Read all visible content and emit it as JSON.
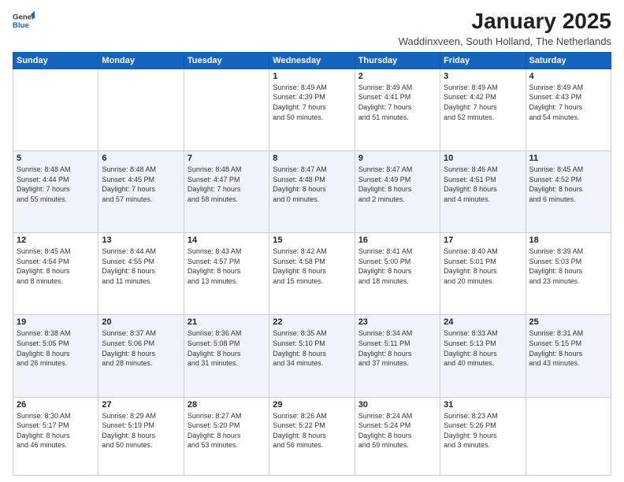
{
  "logo": {
    "general": "General",
    "blue": "Blue"
  },
  "title": "January 2025",
  "subtitle": "Waddinxveen, South Holland, The Netherlands",
  "headers": [
    "Sunday",
    "Monday",
    "Tuesday",
    "Wednesday",
    "Thursday",
    "Friday",
    "Saturday"
  ],
  "weeks": [
    [
      {
        "day": "",
        "info": ""
      },
      {
        "day": "",
        "info": ""
      },
      {
        "day": "",
        "info": ""
      },
      {
        "day": "1",
        "info": "Sunrise: 8:49 AM\nSunset: 4:39 PM\nDaylight: 7 hours\nand 50 minutes."
      },
      {
        "day": "2",
        "info": "Sunrise: 8:49 AM\nSunset: 4:41 PM\nDaylight: 7 hours\nand 51 minutes."
      },
      {
        "day": "3",
        "info": "Sunrise: 8:49 AM\nSunset: 4:42 PM\nDaylight: 7 hours\nand 52 minutes."
      },
      {
        "day": "4",
        "info": "Sunrise: 8:49 AM\nSunset: 4:43 PM\nDaylight: 7 hours\nand 54 minutes."
      }
    ],
    [
      {
        "day": "5",
        "info": "Sunrise: 8:48 AM\nSunset: 4:44 PM\nDaylight: 7 hours\nand 55 minutes."
      },
      {
        "day": "6",
        "info": "Sunrise: 8:48 AM\nSunset: 4:45 PM\nDaylight: 7 hours\nand 57 minutes."
      },
      {
        "day": "7",
        "info": "Sunrise: 8:48 AM\nSunset: 4:47 PM\nDaylight: 7 hours\nand 58 minutes."
      },
      {
        "day": "8",
        "info": "Sunrise: 8:47 AM\nSunset: 4:48 PM\nDaylight: 8 hours\nand 0 minutes."
      },
      {
        "day": "9",
        "info": "Sunrise: 8:47 AM\nSunset: 4:49 PM\nDaylight: 8 hours\nand 2 minutes."
      },
      {
        "day": "10",
        "info": "Sunrise: 8:46 AM\nSunset: 4:51 PM\nDaylight: 8 hours\nand 4 minutes."
      },
      {
        "day": "11",
        "info": "Sunrise: 8:45 AM\nSunset: 4:52 PM\nDaylight: 8 hours\nand 6 minutes."
      }
    ],
    [
      {
        "day": "12",
        "info": "Sunrise: 8:45 AM\nSunset: 4:54 PM\nDaylight: 8 hours\nand 8 minutes."
      },
      {
        "day": "13",
        "info": "Sunrise: 8:44 AM\nSunset: 4:55 PM\nDaylight: 8 hours\nand 11 minutes."
      },
      {
        "day": "14",
        "info": "Sunrise: 8:43 AM\nSunset: 4:57 PM\nDaylight: 8 hours\nand 13 minutes."
      },
      {
        "day": "15",
        "info": "Sunrise: 8:42 AM\nSunset: 4:58 PM\nDaylight: 8 hours\nand 15 minutes."
      },
      {
        "day": "16",
        "info": "Sunrise: 8:41 AM\nSunset: 5:00 PM\nDaylight: 8 hours\nand 18 minutes."
      },
      {
        "day": "17",
        "info": "Sunrise: 8:40 AM\nSunset: 5:01 PM\nDaylight: 8 hours\nand 20 minutes."
      },
      {
        "day": "18",
        "info": "Sunrise: 8:39 AM\nSunset: 5:03 PM\nDaylight: 8 hours\nand 23 minutes."
      }
    ],
    [
      {
        "day": "19",
        "info": "Sunrise: 8:38 AM\nSunset: 5:05 PM\nDaylight: 8 hours\nand 26 minutes."
      },
      {
        "day": "20",
        "info": "Sunrise: 8:37 AM\nSunset: 5:06 PM\nDaylight: 8 hours\nand 28 minutes."
      },
      {
        "day": "21",
        "info": "Sunrise: 8:36 AM\nSunset: 5:08 PM\nDaylight: 8 hours\nand 31 minutes."
      },
      {
        "day": "22",
        "info": "Sunrise: 8:35 AM\nSunset: 5:10 PM\nDaylight: 8 hours\nand 34 minutes."
      },
      {
        "day": "23",
        "info": "Sunrise: 8:34 AM\nSunset: 5:11 PM\nDaylight: 8 hours\nand 37 minutes."
      },
      {
        "day": "24",
        "info": "Sunrise: 8:33 AM\nSunset: 5:13 PM\nDaylight: 8 hours\nand 40 minutes."
      },
      {
        "day": "25",
        "info": "Sunrise: 8:31 AM\nSunset: 5:15 PM\nDaylight: 8 hours\nand 43 minutes."
      }
    ],
    [
      {
        "day": "26",
        "info": "Sunrise: 8:30 AM\nSunset: 5:17 PM\nDaylight: 8 hours\nand 46 minutes."
      },
      {
        "day": "27",
        "info": "Sunrise: 8:29 AM\nSunset: 5:19 PM\nDaylight: 8 hours\nand 50 minutes."
      },
      {
        "day": "28",
        "info": "Sunrise: 8:27 AM\nSunset: 5:20 PM\nDaylight: 8 hours\nand 53 minutes."
      },
      {
        "day": "29",
        "info": "Sunrise: 8:26 AM\nSunset: 5:22 PM\nDaylight: 8 hours\nand 56 minutes."
      },
      {
        "day": "30",
        "info": "Sunrise: 8:24 AM\nSunset: 5:24 PM\nDaylight: 8 hours\nand 59 minutes."
      },
      {
        "day": "31",
        "info": "Sunrise: 8:23 AM\nSunset: 5:26 PM\nDaylight: 9 hours\nand 3 minutes."
      },
      {
        "day": "",
        "info": ""
      }
    ]
  ]
}
